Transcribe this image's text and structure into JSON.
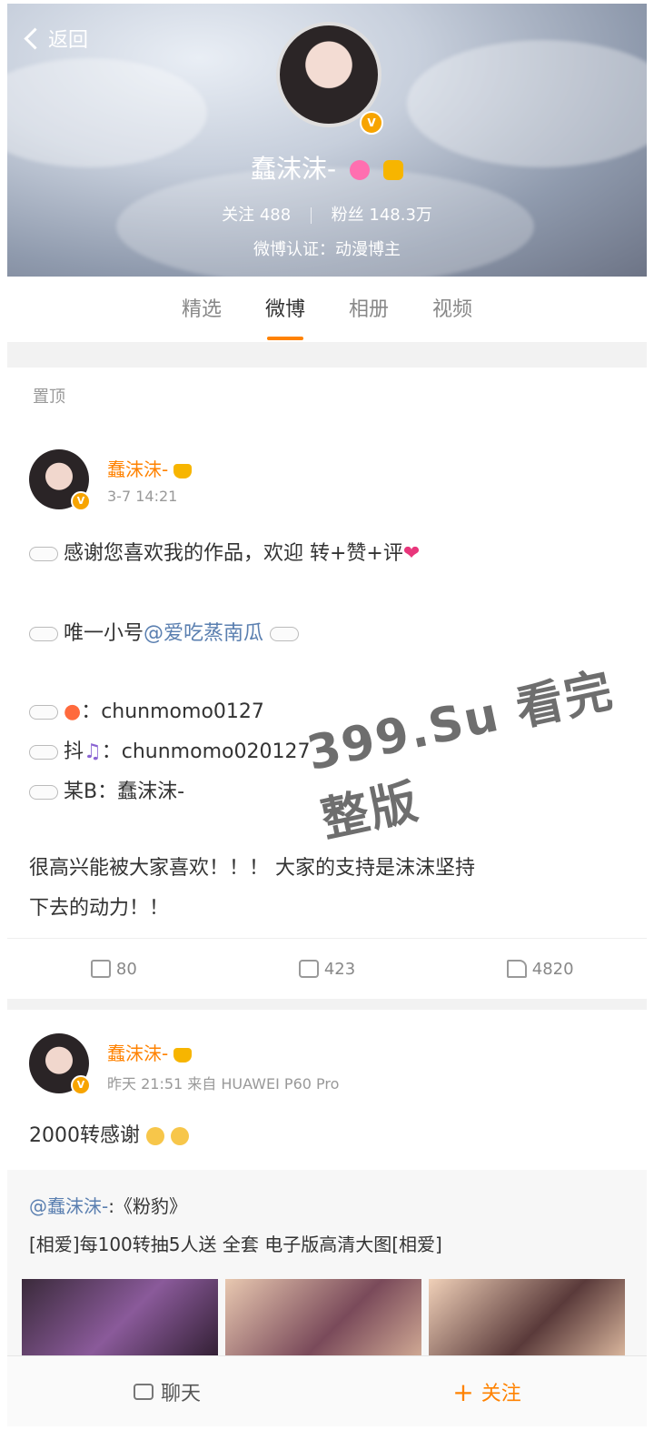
{
  "header": {
    "back_label": "返回",
    "name": "蠢沫沫-",
    "verify_badge": "V",
    "following_label": "关注",
    "following_count": "488",
    "followers_label": "粉丝",
    "followers_count": "148.3万",
    "verification": "微博认证：动漫博主"
  },
  "tabs": [
    {
      "label": "精选"
    },
    {
      "label": "微博"
    },
    {
      "label": "相册"
    },
    {
      "label": "视频"
    }
  ],
  "post1": {
    "pinned_label": "置顶",
    "username": "蠢沫沫-",
    "badge": "V",
    "time": "3-7 14:21",
    "line1": "感谢您喜欢我的作品，欢迎 转+赞+评",
    "line2_prefix": "唯一小号",
    "line2_link": "@爱吃蒸南瓜",
    "line3": "：chunmomo0127",
    "line4_prefix": "抖",
    "line4": "：chunmomo020127",
    "line5": "某B：蠢沫沫-",
    "para1": "很高兴能被大家喜欢！！！ 大家的支持是沫沫坚持",
    "para2": "下去的动力！！",
    "reposts": "80",
    "comments": "423",
    "likes": "4820"
  },
  "post2": {
    "username": "蠢沫沫-",
    "badge": "V",
    "meta": "昨天 21:51 来自 HUAWEI P60 Pro",
    "text": "2000转感谢",
    "quote_user": "@蠢沫沫-",
    "quote_title": ":《粉豹》",
    "quote_text": "[相爱]每100转抽5人送 全套 电子版高清大图[相爱]"
  },
  "bottom": {
    "chat_label": "聊天",
    "follow_label": "关注"
  },
  "watermark": "399.Su 看完整版",
  "colors": {
    "accent": "#ff8200",
    "link": "#5a7fb0",
    "verified": "#f7a400"
  }
}
